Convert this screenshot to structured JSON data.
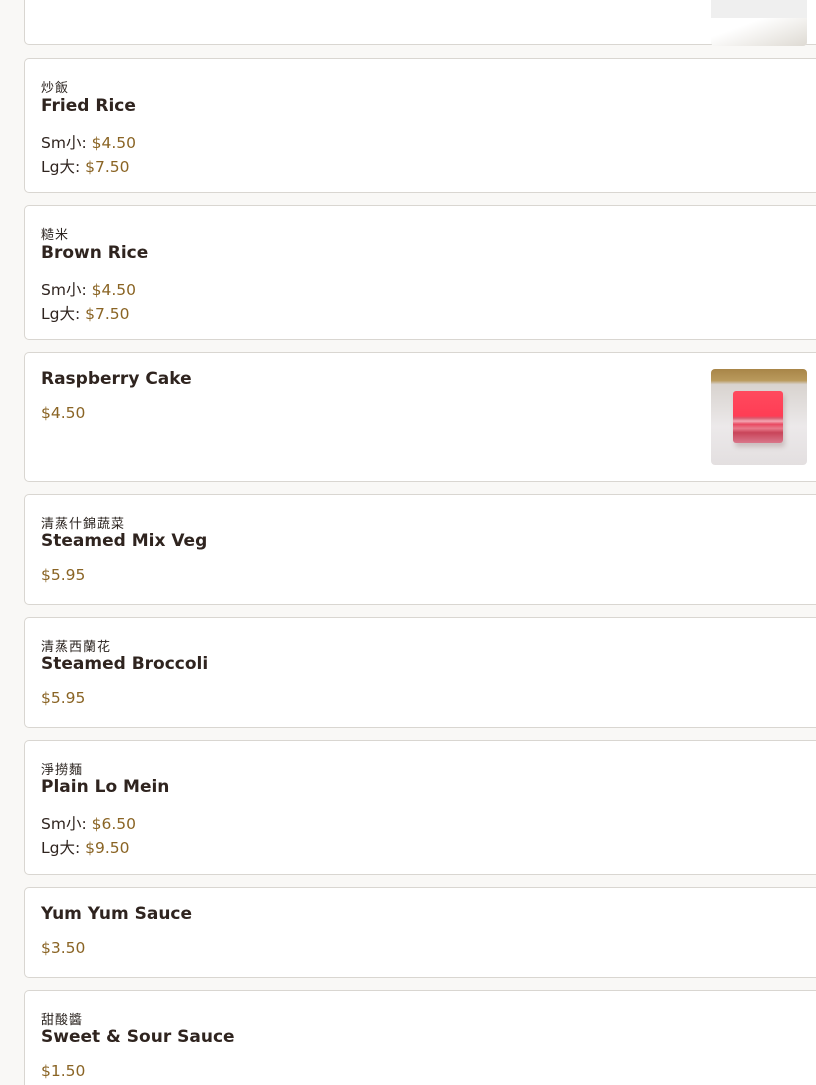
{
  "menu_items": [
    {
      "id": "top-partial",
      "has_image": true,
      "image_icon": "yellow-cake-photo-icon"
    },
    {
      "id": "fried-rice",
      "chinese": "炒飯",
      "name": "Fried Rice",
      "sizes": [
        {
          "label": "Sm小",
          "sep": ": ",
          "price": "$4.50"
        },
        {
          "label": "Lg大",
          "sep": ": ",
          "price": "$7.50"
        }
      ]
    },
    {
      "id": "brown-rice",
      "chinese": "糙米",
      "name": "Brown Rice",
      "sizes": [
        {
          "label": "Sm小",
          "sep": ": ",
          "price": "$4.50"
        },
        {
          "label": "Lg大",
          "sep": ": ",
          "price": "$7.50"
        }
      ]
    },
    {
      "id": "raspberry-cake",
      "name": "Raspberry Cake",
      "price": "$4.50",
      "image_icon": "raspberry-cake-photo-icon"
    },
    {
      "id": "steamed-mix-veg",
      "chinese": "清蒸什錦蔬菜",
      "name": "Steamed Mix Veg",
      "price": "$5.95"
    },
    {
      "id": "steamed-broccoli",
      "chinese": "清蒸西蘭花",
      "name": "Steamed Broccoli",
      "price": "$5.95"
    },
    {
      "id": "plain-lo-mein",
      "chinese": "淨撈麵",
      "name": "Plain Lo Mein",
      "sizes": [
        {
          "label": "Sm小",
          "sep": ": ",
          "price": "$6.50"
        },
        {
          "label": "Lg大",
          "sep": ": ",
          "price": "$9.50"
        }
      ]
    },
    {
      "id": "yum-yum-sauce",
      "name": "Yum Yum Sauce",
      "price": "$3.50"
    },
    {
      "id": "sweet-sour-sauce",
      "chinese": "甜酸醬",
      "name": "Sweet & Sour Sauce",
      "price": "$1.50"
    }
  ],
  "colors": {
    "background": "#f9f8f6",
    "card": "#ffffff",
    "border": "#d9d6d1",
    "text": "#2f241f",
    "price": "#8a6424"
  }
}
